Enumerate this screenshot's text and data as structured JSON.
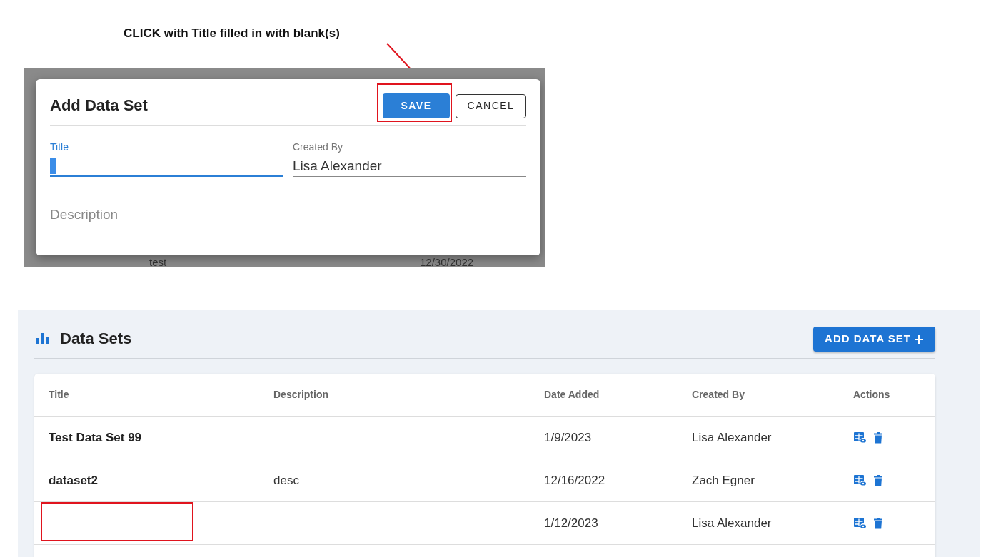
{
  "annotation": {
    "text": "CLICK with Title filled in with blank(s)"
  },
  "dialog": {
    "title": "Add Data Set",
    "buttons": [
      {
        "label": "SAVE",
        "kind": "primary",
        "highlighted": true
      },
      {
        "label": "CANCEL",
        "kind": "outline",
        "highlighted": false
      }
    ],
    "fields": [
      {
        "label": "Title",
        "focused": true
      },
      {
        "label": "Created By",
        "value": "Lisa Alexander",
        "focused": false
      },
      {
        "placeholder": "Description",
        "focused": false
      }
    ],
    "background_row": {
      "title": "test",
      "date_added": "12/30/2022"
    }
  },
  "page": {
    "title": "Data Sets",
    "add_button": "ADD DATA SET"
  },
  "table": {
    "columns": [
      "Title",
      "Description",
      "Date Added",
      "Created By",
      "Actions"
    ],
    "rows": [
      {
        "title": "Test Data Set 99",
        "date_added": "1/9/2023",
        "created_by": "Lisa Alexander",
        "title_highlighted": false
      },
      {
        "title": "dataset2",
        "description": "desc",
        "date_added": "12/16/2022",
        "created_by": "Zach Egner",
        "title_highlighted": false
      },
      {
        "date_added": "1/12/2023",
        "created_by": "Lisa Alexander",
        "title_highlighted": true
      }
    ]
  }
}
